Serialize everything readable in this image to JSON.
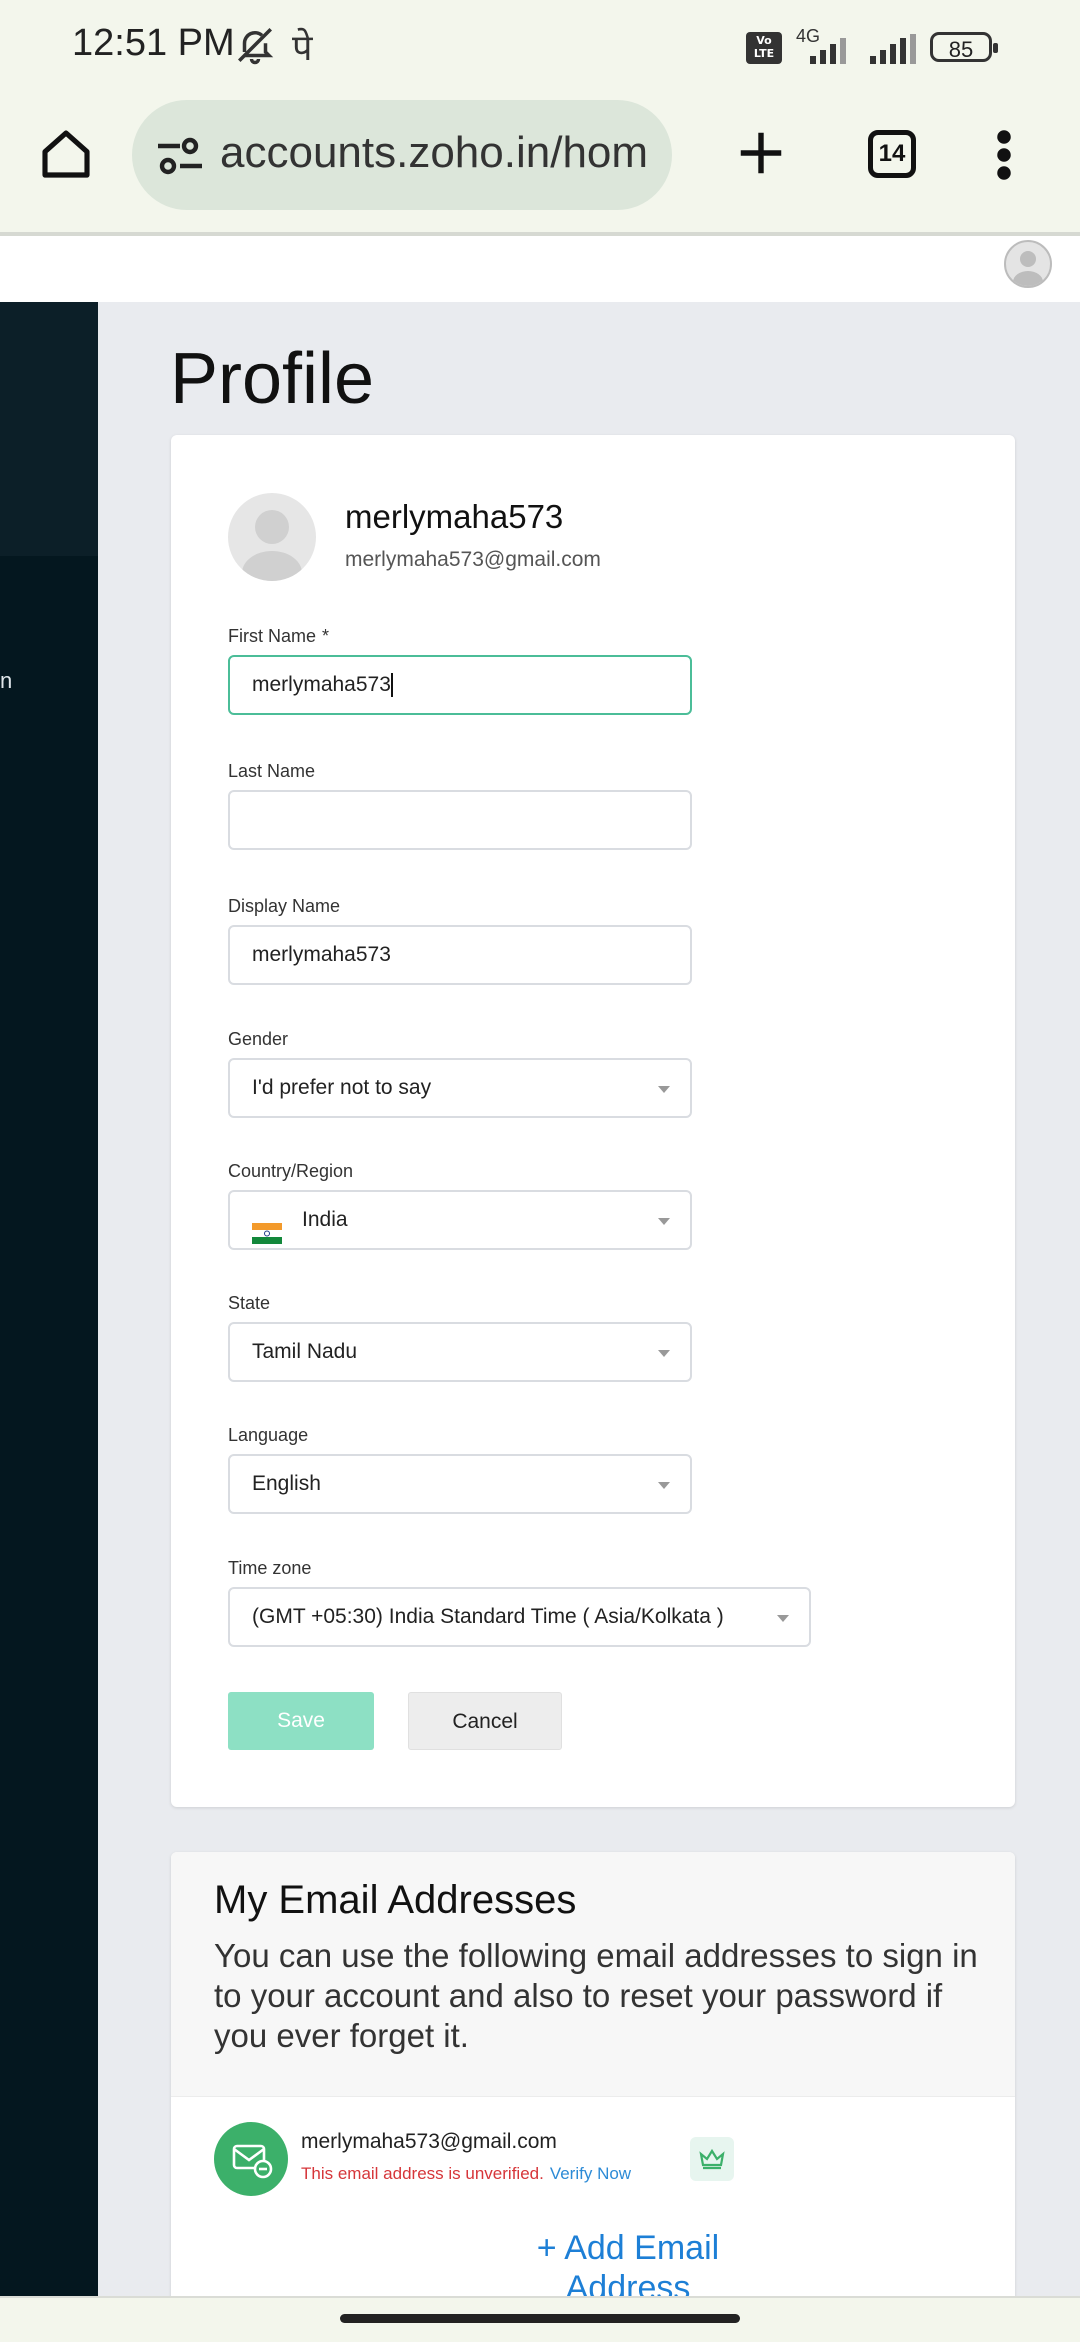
{
  "status_bar": {
    "time": "12:51 PM",
    "hindi_glyph": "पे",
    "volte": "Vo LTE",
    "network": "4G",
    "battery": "85"
  },
  "browser": {
    "url": "accounts.zoho.in/hom",
    "tab_count": "14"
  },
  "sidebar": {
    "partial_text": "n"
  },
  "page": {
    "title": "Profile"
  },
  "profile": {
    "name": "merlymaha573",
    "email": "merlymaha573@gmail.com"
  },
  "form": {
    "first_name": {
      "label": "First Name",
      "required_mark": "*",
      "value": "merlymaha573"
    },
    "last_name": {
      "label": "Last Name",
      "value": ""
    },
    "display_name": {
      "label": "Display Name",
      "value": "merlymaha573"
    },
    "gender": {
      "label": "Gender",
      "value": "I'd prefer not to say"
    },
    "country": {
      "label": "Country/Region",
      "value": "India"
    },
    "state": {
      "label": "State",
      "value": "Tamil Nadu"
    },
    "language": {
      "label": "Language",
      "value": "English"
    },
    "timezone": {
      "label": "Time zone",
      "value": "(GMT +05:30) India Standard Time ( Asia/Kolkata )"
    },
    "save_label": "Save",
    "cancel_label": "Cancel"
  },
  "emails_section": {
    "heading": "My Email Addresses",
    "description": "You can use the following email addresses to sign in to your account and also to reset your password if you ever forget it.",
    "email": "merlymaha573@gmail.com",
    "unverified_text": "This email address is unverified.",
    "verify_label": "Verify Now",
    "add_email_label": "+ Add Email Address"
  },
  "colors": {
    "accent_green": "#4bbd98",
    "save_button": "#8de0c4",
    "sidebar": "#04171f",
    "error_red": "#d6363a",
    "link_blue": "#2d8bd6"
  }
}
